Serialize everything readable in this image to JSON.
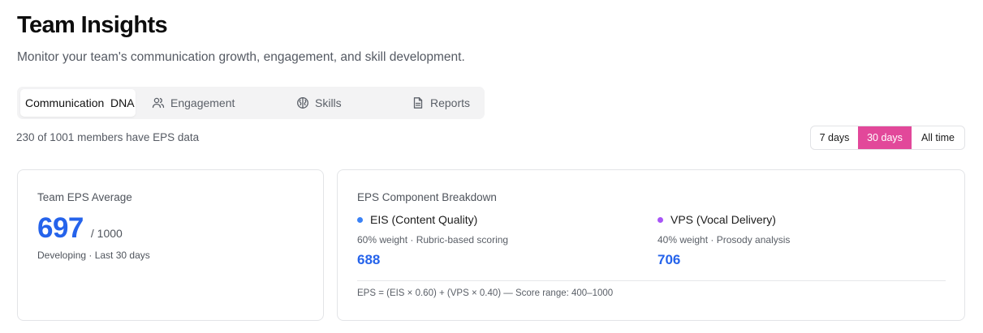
{
  "header": {
    "title": "Team Insights",
    "subtitle": "Monitor your team's communication growth, engagement, and skill development."
  },
  "tabs": [
    {
      "label": "Communication  DNA",
      "icon": "none",
      "active": true
    },
    {
      "label": "Engagement",
      "icon": "users-icon",
      "active": false
    },
    {
      "label": "Skills",
      "icon": "brain-icon",
      "active": false
    },
    {
      "label": "Reports",
      "icon": "document-icon",
      "active": false
    }
  ],
  "members_note": "230 of 1001 members have EPS data",
  "time_range": {
    "options": [
      "7 days",
      "30 days",
      "All time"
    ],
    "selected": "30 days",
    "accent_color": "#e2489a"
  },
  "eps_average": {
    "label": "Team EPS Average",
    "value": "697",
    "max": "/ 1000",
    "status": "Developing · Last 30 days"
  },
  "breakdown": {
    "label": "EPS Component Breakdown",
    "eis": {
      "title": "EIS (Content Quality)",
      "weight": "60% weight · Rubric-based scoring",
      "score": "688",
      "dot_color": "#3b82f6"
    },
    "vps": {
      "title": "VPS (Vocal Delivery)",
      "weight": "40% weight · Prosody analysis",
      "score": "706",
      "dot_color": "#a855f7"
    },
    "formula": "EPS = (EIS × 0.60) + (VPS × 0.40) — Score range: 400–1000"
  },
  "colors": {
    "score_blue": "#2563eb"
  }
}
